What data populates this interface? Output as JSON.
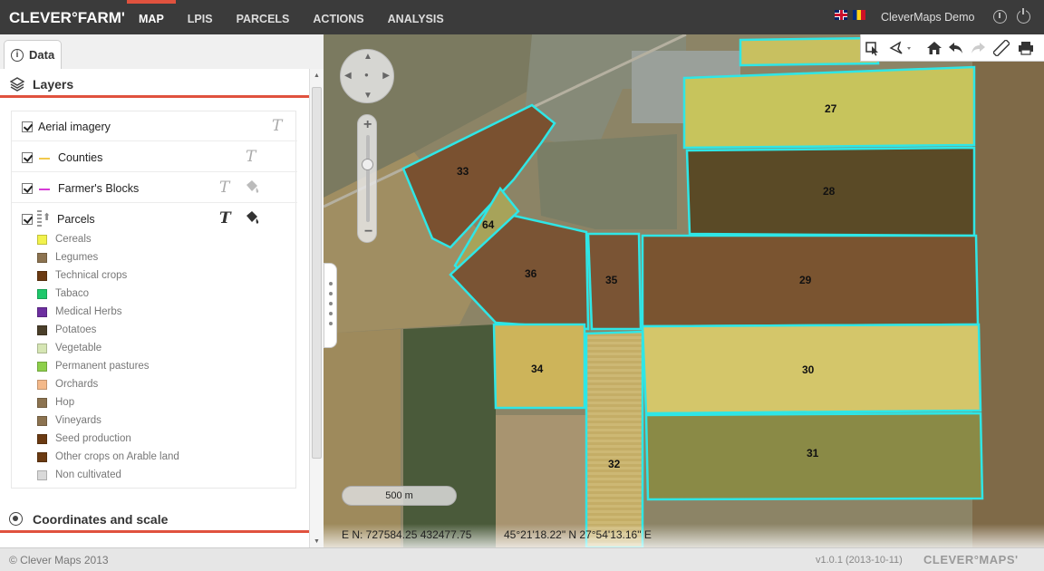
{
  "app": {
    "logo": "CLEVER°FARM'",
    "nav": [
      {
        "label": "MAP",
        "active": true
      },
      {
        "label": "LPIS",
        "active": false
      },
      {
        "label": "PARCELS",
        "active": false
      },
      {
        "label": "ACTIONS",
        "active": false
      },
      {
        "label": "ANALYSIS",
        "active": false
      }
    ],
    "languages": [
      "uk-flag-icon",
      "ro-flag-icon"
    ],
    "user": "CleverMaps Demo",
    "icons": [
      "history-icon",
      "power-icon"
    ]
  },
  "panel": {
    "tab_label": "Data",
    "layers_title": "Layers",
    "coords_title": "Coordinates and scale",
    "layers": [
      {
        "label": "Aerial imagery",
        "checked": true
      },
      {
        "label": "Counties",
        "checked": true,
        "line_color": "#f2c94c"
      },
      {
        "label": "Farmer's Blocks",
        "checked": true,
        "line_color": "#d63bd6"
      },
      {
        "label": "Parcels",
        "checked": true
      }
    ],
    "legend": [
      {
        "label": "Cereals",
        "color": "#f2f24c"
      },
      {
        "label": "Legumes",
        "color": "#8c7350"
      },
      {
        "label": "Technical crops",
        "color": "#6b3a12"
      },
      {
        "label": "Tabaco",
        "color": "#1ec86b"
      },
      {
        "label": "Medical Herbs",
        "color": "#6d2fa0"
      },
      {
        "label": "Potatoes",
        "color": "#4a3f2a"
      },
      {
        "label": "Vegetable",
        "color": "#d6e6b4"
      },
      {
        "label": "Permanent pastures",
        "color": "#8dcf4a"
      },
      {
        "label": "Orchards",
        "color": "#f4b98a"
      },
      {
        "label": "Hop",
        "color": "#8c7350"
      },
      {
        "label": "Vineyards",
        "color": "#8c7350"
      },
      {
        "label": "Seed production",
        "color": "#6b3a12"
      },
      {
        "label": "Other crops on Arable land",
        "color": "#6b3a12"
      },
      {
        "label": "Non cultivated",
        "color": "#d9d9d9"
      }
    ]
  },
  "map": {
    "parcels": [
      "27",
      "28",
      "29",
      "30",
      "31",
      "32",
      "33",
      "34",
      "35",
      "36",
      "64"
    ],
    "scale_label": "500 m",
    "coord_en": "E N: 727584.25 432477.75",
    "coord_latlon": "45°21'18.22\" N 27°54'13.16\" E",
    "toolbar": [
      "identify-icon",
      "draw-icon",
      "home-icon",
      "undo-icon",
      "redo-icon",
      "measure-icon",
      "print-icon"
    ]
  },
  "footer": {
    "copyright": "© Clever Maps 2013",
    "version": "v1.0.1 (2013-10-11)",
    "brand": "CLEVER°MAPS'"
  }
}
